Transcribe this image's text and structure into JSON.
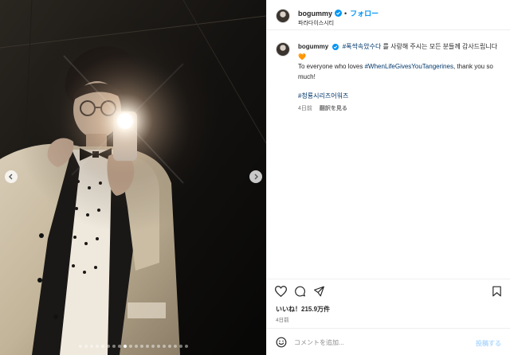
{
  "post": {
    "username": "bogummy",
    "follow_label": "フォロー",
    "location": "파라다이스시티",
    "more_icon": "more-horizontal-icon"
  },
  "caption": {
    "username": "bogummy",
    "hashtag_korean": "#폭싹속았수다",
    "text_korean": " 를 사랑해 주시는 모든 분들께 감사드립니다🧡",
    "text_english_prefix": "To everyone who loves ",
    "hashtag_english": "#WhenLifeGivesYouTangerines",
    "text_english_suffix": ", thank you so much!",
    "hashtag_awards": "#청룡시리즈어워즈",
    "age": "4日前",
    "translate_label": "翻訳を見る"
  },
  "actions": {
    "like_icon": "heart-icon",
    "comment_icon": "comment-icon",
    "share_icon": "send-icon",
    "save_icon": "bookmark-icon"
  },
  "likes_text": "いいね！215.9万件",
  "post_date": "4日前",
  "comment": {
    "placeholder": "コメントを追加...",
    "post_label": "投稿する",
    "emoji_icon": "emoji-smile-icon"
  },
  "carousel": {
    "total": 20,
    "active_index": 8
  },
  "colors": {
    "link_blue": "#0095f6",
    "hashtag": "#00376b",
    "post_button_disabled": "#b3dbff",
    "verified_badge": "#0095f6"
  }
}
